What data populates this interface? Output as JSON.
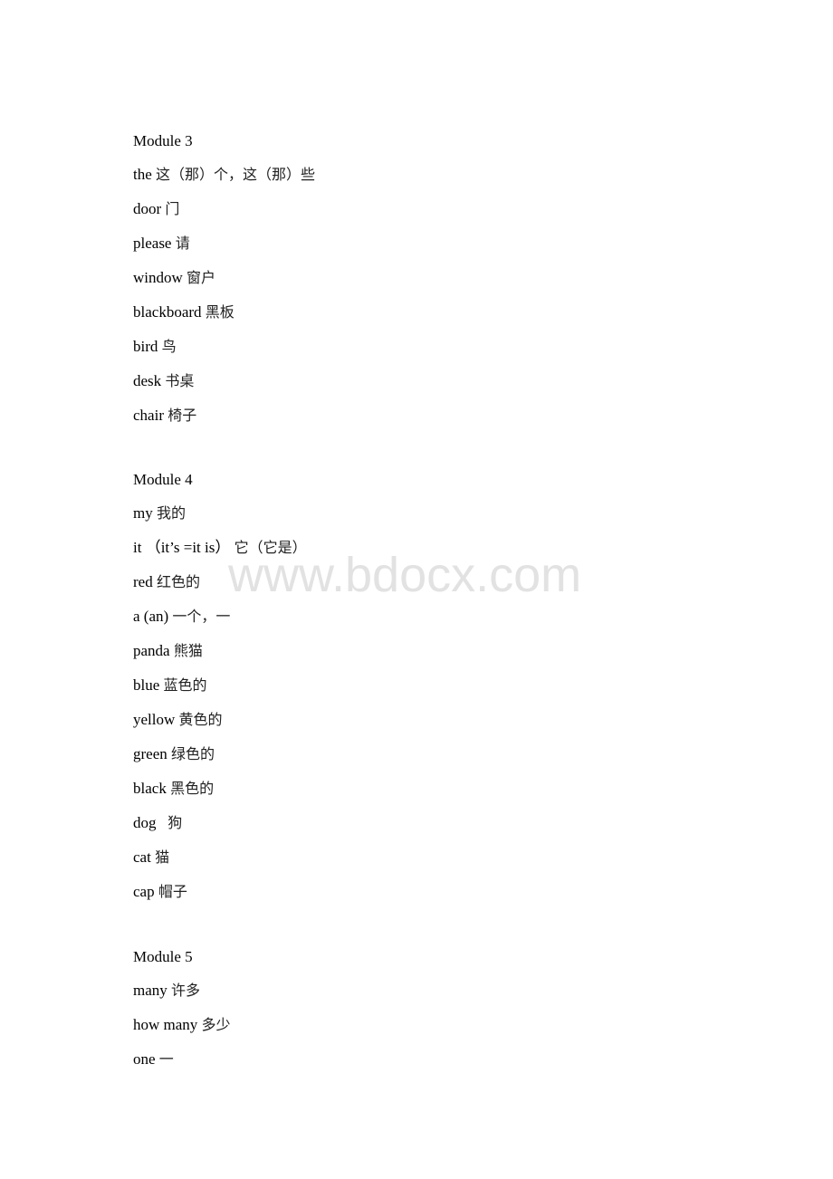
{
  "watermark": "www.bdocx.com",
  "sections": [
    {
      "heading": "Module 3",
      "entries": [
        {
          "en": "the",
          "cn": "这（那）个，这（那）些"
        },
        {
          "en": "door",
          "cn": "门"
        },
        {
          "en": "please",
          "cn": "请"
        },
        {
          "en": "window",
          "cn": "窗户"
        },
        {
          "en": "blackboard",
          "cn": "黑板"
        },
        {
          "en": "bird",
          "cn": "鸟"
        },
        {
          "en": "desk",
          "cn": "书桌"
        },
        {
          "en": "chair",
          "cn": "椅子"
        }
      ]
    },
    {
      "heading": "Module 4",
      "entries": [
        {
          "en": "my",
          "cn": "我的"
        },
        {
          "en": "it （it’s =it is）",
          "cn": "它（它是）"
        },
        {
          "en": "red",
          "cn": "红色的"
        },
        {
          "en": "a (an)",
          "cn": "一个，一"
        },
        {
          "en": "panda",
          "cn": "熊猫"
        },
        {
          "en": "blue",
          "cn": "蓝色的"
        },
        {
          "en": "yellow",
          "cn": "黄色的"
        },
        {
          "en": "green",
          "cn": "绿色的"
        },
        {
          "en": "black",
          "cn": "黑色的"
        },
        {
          "en": "dog  ",
          "cn": "狗"
        },
        {
          "en": "cat",
          "cn": "猫"
        },
        {
          "en": "cap",
          "cn": "帽子"
        }
      ]
    },
    {
      "heading": "Module 5",
      "entries": [
        {
          "en": "many",
          "cn": "许多"
        },
        {
          "en": "how many",
          "cn": "多少"
        },
        {
          "en": "one",
          "cn": "一"
        }
      ]
    }
  ]
}
